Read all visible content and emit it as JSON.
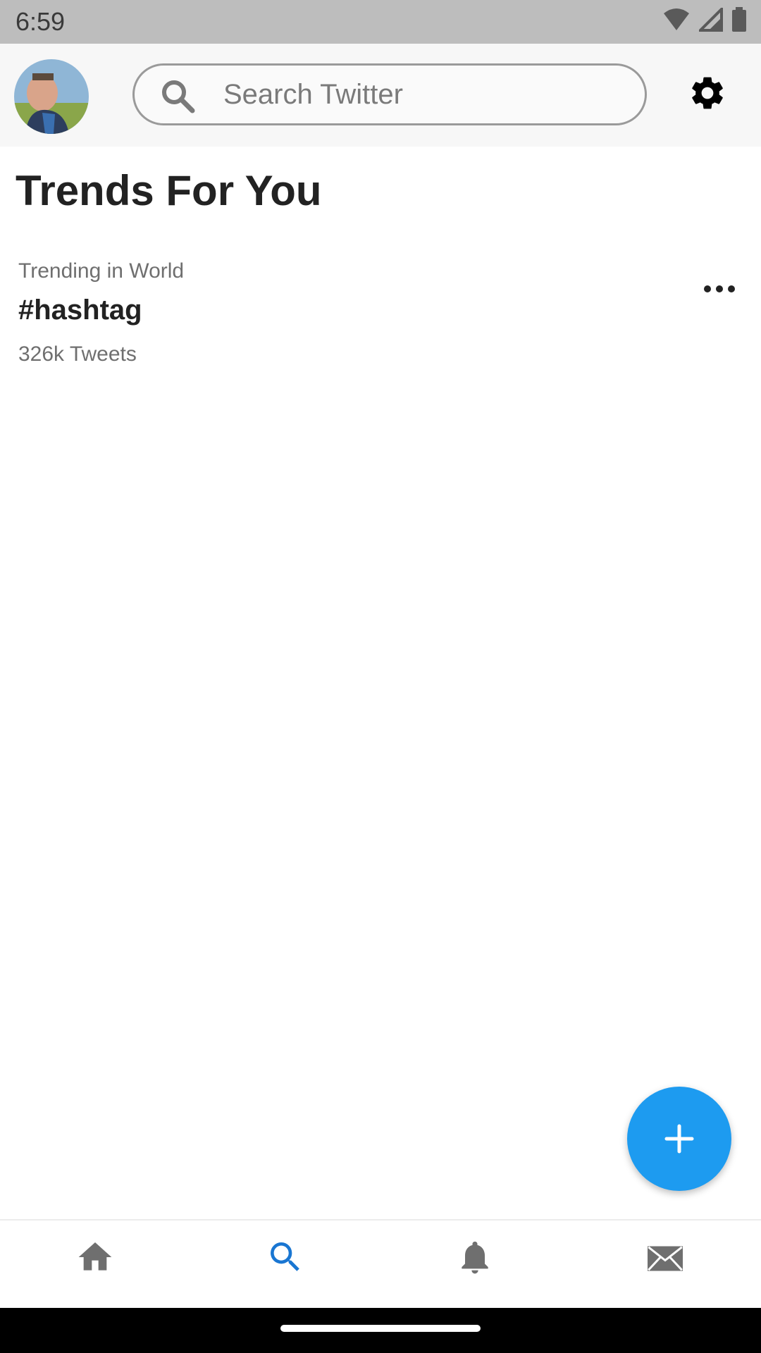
{
  "status": {
    "time": "6:59"
  },
  "header": {
    "search_placeholder": "Search Twitter"
  },
  "page": {
    "title": "Trends For You"
  },
  "trends": [
    {
      "context": "Trending in World",
      "name": "#hashtag",
      "count": "326k Tweets"
    }
  ],
  "nav": {
    "items": [
      "home-icon",
      "search-icon",
      "bell-icon",
      "mail-icon"
    ],
    "active_index": 1
  },
  "colors": {
    "accent": "#1d9bf0",
    "nav_active": "#1976d2",
    "nav_inactive": "#6f6f6f",
    "status_bar": "#bdbdbd"
  }
}
